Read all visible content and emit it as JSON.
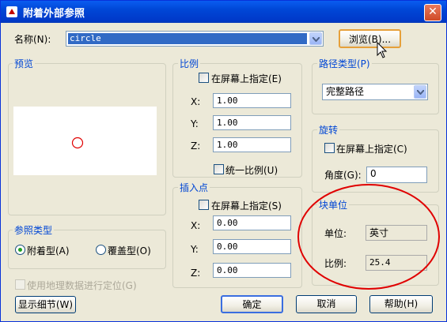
{
  "window": {
    "title": "附着外部参照",
    "close_label": "✕"
  },
  "name_row": {
    "label": "名称(N):",
    "value": "circle",
    "browse_label": "浏览(B)..."
  },
  "preview": {
    "title": "预览"
  },
  "scale": {
    "title": "比例",
    "specify_label": "在屏幕上指定(E)",
    "x_label": "X:",
    "x_value": "1.00",
    "y_label": "Y:",
    "y_value": "1.00",
    "z_label": "Z:",
    "z_value": "1.00",
    "uniform_label": "统一比例(U)"
  },
  "insert": {
    "title": "插入点",
    "specify_label": "在屏幕上指定(S)",
    "x_label": "X:",
    "x_value": "0.00",
    "y_label": "Y:",
    "y_value": "0.00",
    "z_label": "Z:",
    "z_value": "0.00"
  },
  "path_type": {
    "title": "路径类型(P)",
    "value": "完整路径"
  },
  "rotation": {
    "title": "旋转",
    "specify_label": "在屏幕上指定(C)",
    "angle_label": "角度(G):",
    "angle_value": "0"
  },
  "block_unit": {
    "title": "块单位",
    "unit_label": "单位:",
    "unit_value": "英寸",
    "factor_label": "比例:",
    "factor_value": "25.4"
  },
  "ref_type": {
    "title": "参照类型",
    "attach_label": "附着型(A)",
    "overlay_label": "覆盖型(O)"
  },
  "geo_label": "使用地理数据进行定位(G)",
  "buttons": {
    "details": "显示细节(W)",
    "ok": "确定",
    "cancel": "取消",
    "help": "帮助(H)"
  },
  "colors": {
    "title_bar": "#0047d6",
    "annotation": "#e00000",
    "group_title": "#0046d5"
  }
}
